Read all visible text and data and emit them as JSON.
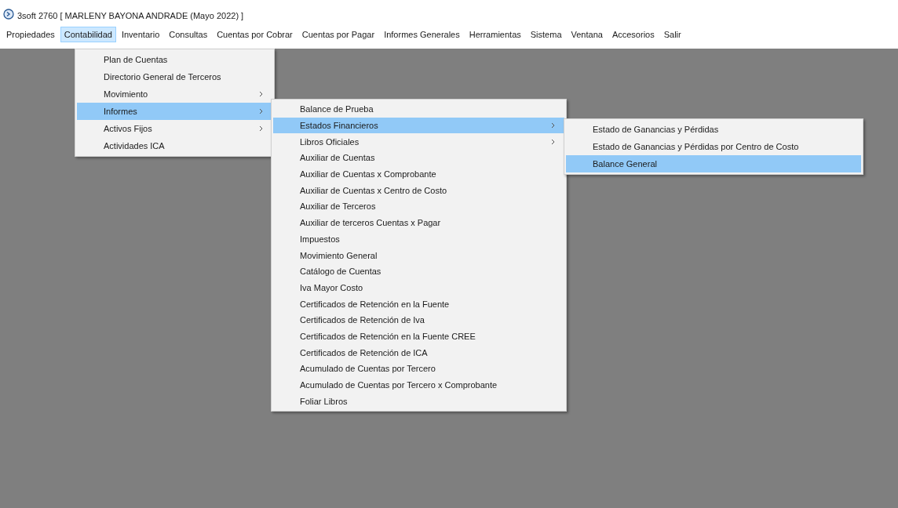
{
  "window": {
    "title": "3soft  2760  [ MARLENY BAYONA ANDRADE (Mayo  2022) ]"
  },
  "menubar": [
    {
      "label": "Propiedades",
      "selected": false
    },
    {
      "label": "Contabilidad",
      "selected": true
    },
    {
      "label": "Inventario",
      "selected": false
    },
    {
      "label": "Consultas",
      "selected": false
    },
    {
      "label": "Cuentas por Cobrar",
      "selected": false
    },
    {
      "label": "Cuentas por Pagar",
      "selected": false
    },
    {
      "label": "Informes Generales",
      "selected": false
    },
    {
      "label": "Herramientas",
      "selected": false
    },
    {
      "label": "Sistema",
      "selected": false
    },
    {
      "label": "Ventana",
      "selected": false
    },
    {
      "label": "Accesorios",
      "selected": false
    },
    {
      "label": "Salir",
      "selected": false
    }
  ],
  "menus": [
    {
      "items": [
        {
          "label": "Plan de Cuentas",
          "selected": false,
          "submenu": false
        },
        {
          "label": "Directorio General de Terceros",
          "selected": false,
          "submenu": false
        },
        {
          "label": "Movimiento",
          "selected": false,
          "submenu": true
        },
        {
          "label": "Informes",
          "selected": true,
          "submenu": true
        },
        {
          "label": "Activos Fijos",
          "selected": false,
          "submenu": true
        },
        {
          "label": "Actividades ICA",
          "selected": false,
          "submenu": false
        }
      ]
    },
    {
      "items": [
        {
          "label": "Balance de Prueba",
          "selected": false,
          "submenu": false
        },
        {
          "label": "Estados Financieros",
          "selected": true,
          "submenu": true
        },
        {
          "label": "Libros Oficiales",
          "selected": false,
          "submenu": true
        },
        {
          "label": "Auxiliar de Cuentas",
          "selected": false,
          "submenu": false
        },
        {
          "label": "Auxiliar de Cuentas x Comprobante",
          "selected": false,
          "submenu": false
        },
        {
          "label": "Auxiliar de Cuentas x Centro de Costo",
          "selected": false,
          "submenu": false
        },
        {
          "label": "Auxiliar de Terceros",
          "selected": false,
          "submenu": false
        },
        {
          "label": "Auxiliar de terceros Cuentas x Pagar",
          "selected": false,
          "submenu": false
        },
        {
          "label": "Impuestos",
          "selected": false,
          "submenu": false
        },
        {
          "label": "Movimiento General",
          "selected": false,
          "submenu": false
        },
        {
          "label": "Catálogo de Cuentas",
          "selected": false,
          "submenu": false
        },
        {
          "label": "Iva Mayor Costo",
          "selected": false,
          "submenu": false
        },
        {
          "label": "Certificados de Retención en la Fuente",
          "selected": false,
          "submenu": false
        },
        {
          "label": "Certificados de Retención de Iva",
          "selected": false,
          "submenu": false
        },
        {
          "label": "Certificados de Retención en la Fuente CREE",
          "selected": false,
          "submenu": false
        },
        {
          "label": "Certificados de Retención de ICA",
          "selected": false,
          "submenu": false
        },
        {
          "label": "Acumulado de Cuentas por Tercero",
          "selected": false,
          "submenu": false
        },
        {
          "label": "Acumulado de Cuentas por Tercero x Comprobante",
          "selected": false,
          "submenu": false
        },
        {
          "label": "Foliar Libros",
          "selected": false,
          "submenu": false
        }
      ]
    },
    {
      "items": [
        {
          "label": "Estado de Ganancias y Pérdidas",
          "selected": false,
          "submenu": false
        },
        {
          "label": "Estado de Ganancias y Pérdidas por Centro de Costo",
          "selected": false,
          "submenu": false
        },
        {
          "label": "Balance General",
          "selected": true,
          "submenu": false
        }
      ]
    }
  ]
}
